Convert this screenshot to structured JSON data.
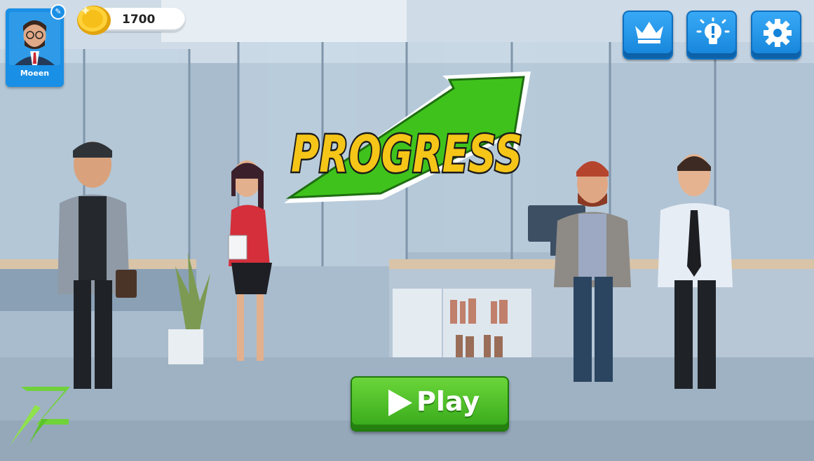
{
  "player": {
    "name": "Moeen"
  },
  "currency": {
    "coins": "1700"
  },
  "title": {
    "word": "PROGRESS"
  },
  "actions": {
    "play_label": "Play"
  },
  "toolbar": {
    "leaderboard_icon": "crown-icon",
    "tips_icon": "lightbulb-icon",
    "settings_icon": "gear-icon"
  },
  "colors": {
    "button_blue": "#1a8fe6",
    "play_green": "#43b823",
    "title_yellow": "#f5c518",
    "arrow_green": "#3fc31c"
  }
}
